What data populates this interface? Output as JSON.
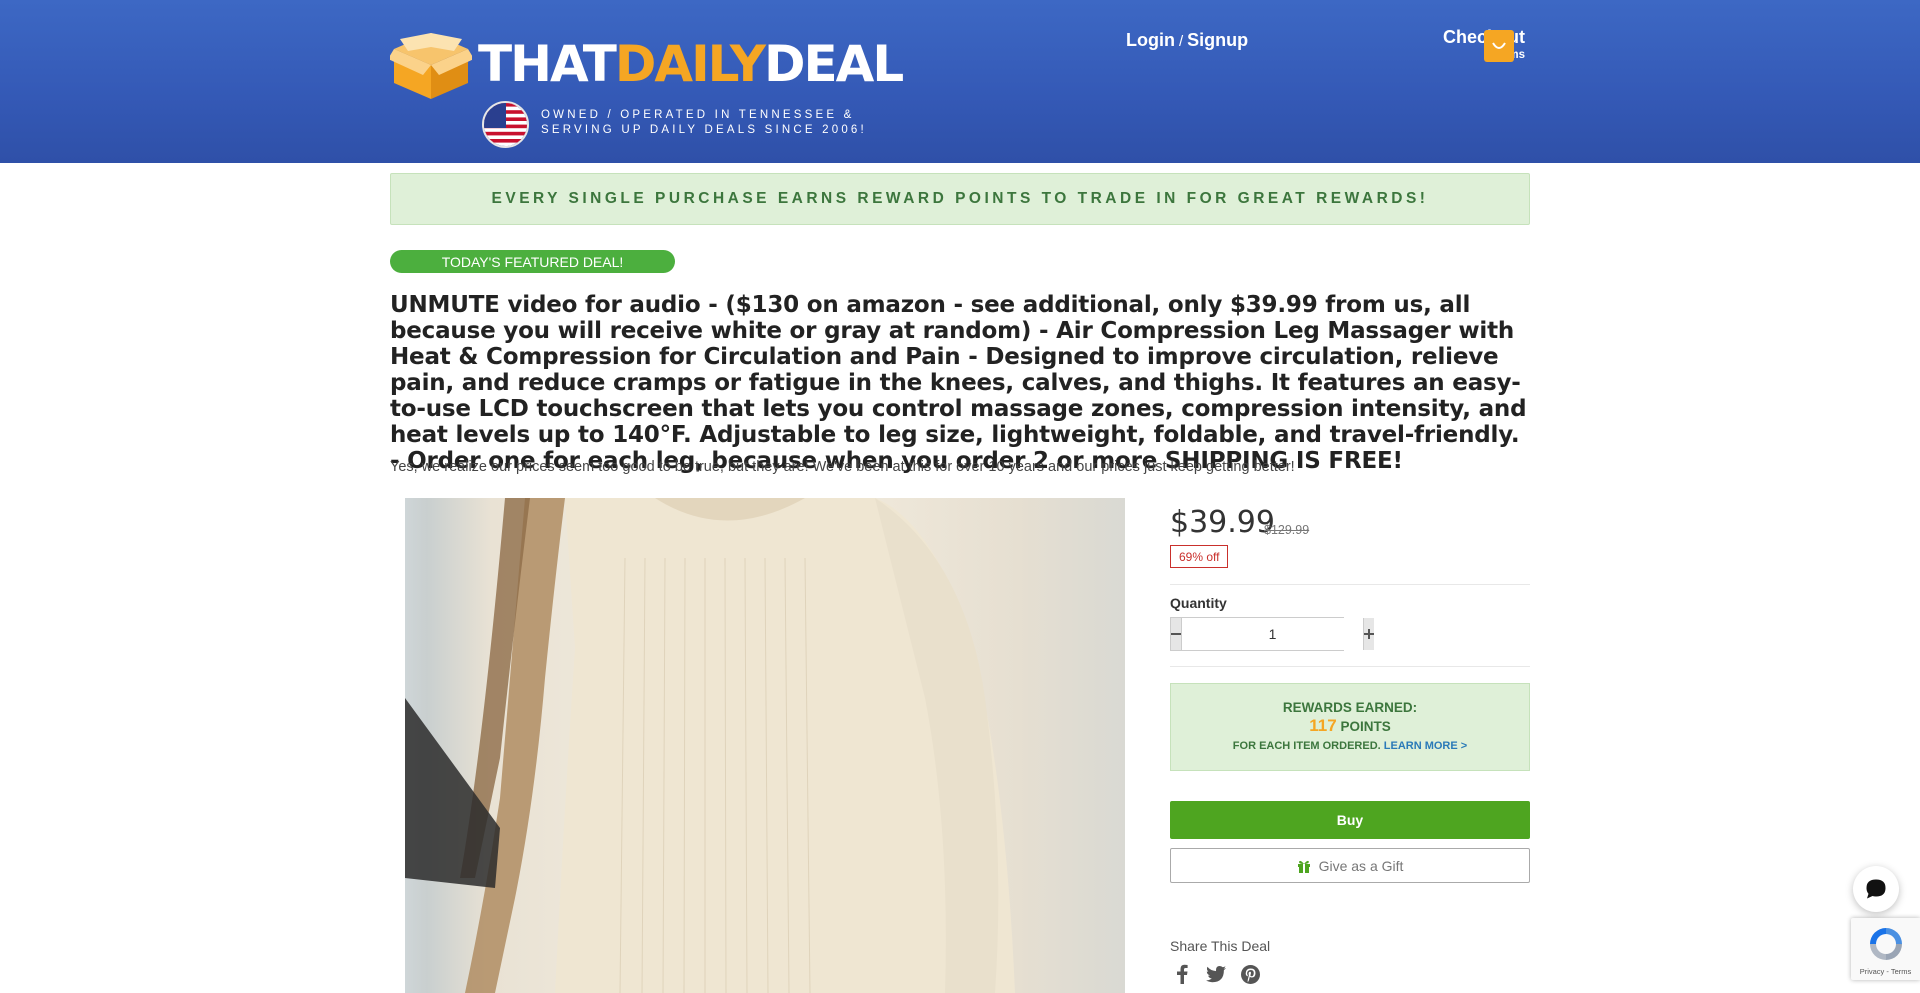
{
  "header": {
    "logo_left": "THAT",
    "logo_mid": "DAILY",
    "logo_right": "DEAL",
    "tagline_line1": "OWNED / OPERATED IN TENNESSEE &",
    "tagline_line2": "SERVING UP DAILY DEALS SINCE 2006!",
    "login": "Login",
    "separator": "/",
    "signup": "Signup",
    "checkout": "Checkout",
    "items": "0 items"
  },
  "rewards_banner": "EVERY SINGLE PURCHASE EARNS REWARD POINTS TO TRADE IN FOR GREAT REWARDS!",
  "featured_label": "TODAY'S FEATURED DEAL!",
  "product": {
    "title": "UNMUTE video for audio - ($130 on amazon - see additional, only $39.99 from us, all because you will receive white or gray at random) - Air Compression Leg Massager with Heat & Compression for Circulation and Pain - Designed to improve circulation, relieve pain, and reduce cramps or fatigue in the knees, calves, and thighs. It features an easy-to-use LCD touchscreen that lets you control massage zones, compression intensity, and heat levels up to 140°F. Adjustable to leg size, lightweight, foldable, and travel-friendly. - Order one for each leg, because when you order 2 or more SHIPPING IS FREE!",
    "subtitle": "Yes, we realize our prices seem too good to be true, but they are! We've been at this for over 10 years and our prices just keep getting better!",
    "price": "$39.99",
    "old_price": "$129.99",
    "discount": "69% off",
    "quantity_label": "Quantity",
    "quantity_value": "1"
  },
  "rewards": {
    "earned_label": "REWARDS EARNED:",
    "points_value": "117",
    "points_label": "POINTS",
    "per_item": "FOR EACH ITEM ORDERED.",
    "learn_more": "LEARN MORE >"
  },
  "actions": {
    "buy": "Buy",
    "gift": "Give as a Gift"
  },
  "share": {
    "label": "Share This Deal",
    "icons": [
      "facebook-icon",
      "twitter-icon",
      "pinterest-icon"
    ]
  },
  "recaptcha": {
    "privacy": "Privacy",
    "separator": " - ",
    "terms": "Terms"
  },
  "colors": {
    "header_blue": "#3459b6",
    "accent_orange": "#f5a623",
    "buy_green": "#4ea520",
    "reward_green": "#3c763d"
  }
}
